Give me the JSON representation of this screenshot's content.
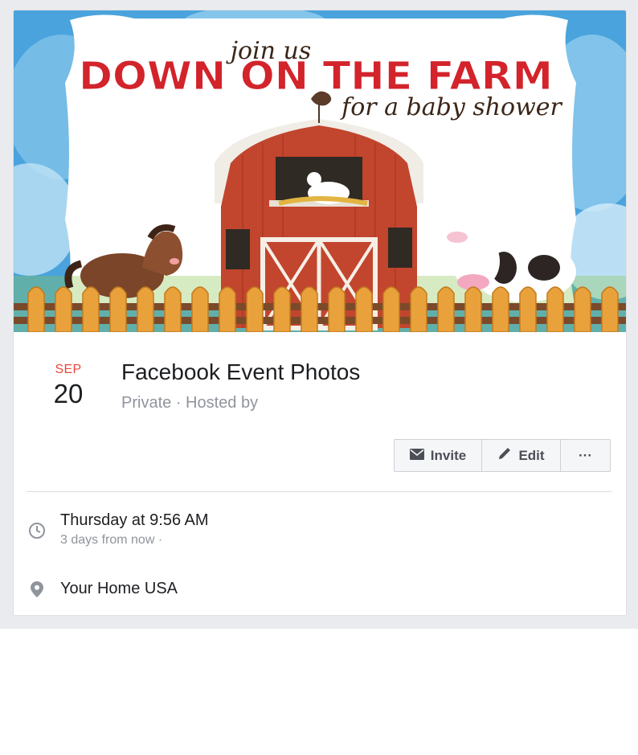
{
  "cover": {
    "line1": "join us",
    "line2": "DOWN ON THE FARM",
    "line3": "for a baby shower"
  },
  "event": {
    "month": "SEP",
    "day": "20",
    "title": "Facebook Event Photos",
    "privacy": "Private",
    "separator": "·",
    "hosted": "Hosted by"
  },
  "actions": {
    "invite_label": "Invite",
    "edit_label": "Edit",
    "more_label": "···"
  },
  "details": {
    "time_main": "Thursday at 9:56 AM",
    "time_sub": "3 days from now ·",
    "location": "Your Home USA"
  },
  "colors": {
    "page_bg": "#e9ebee",
    "accent_red": "#e9473b",
    "text_dark": "#1c1e21",
    "text_muted": "#90949c",
    "button_bg": "#f5f6f7"
  },
  "icons": {
    "invite": "envelope-icon",
    "edit": "pencil-icon",
    "more": "ellipsis-icon",
    "time": "clock-icon",
    "location": "map-pin-icon"
  }
}
